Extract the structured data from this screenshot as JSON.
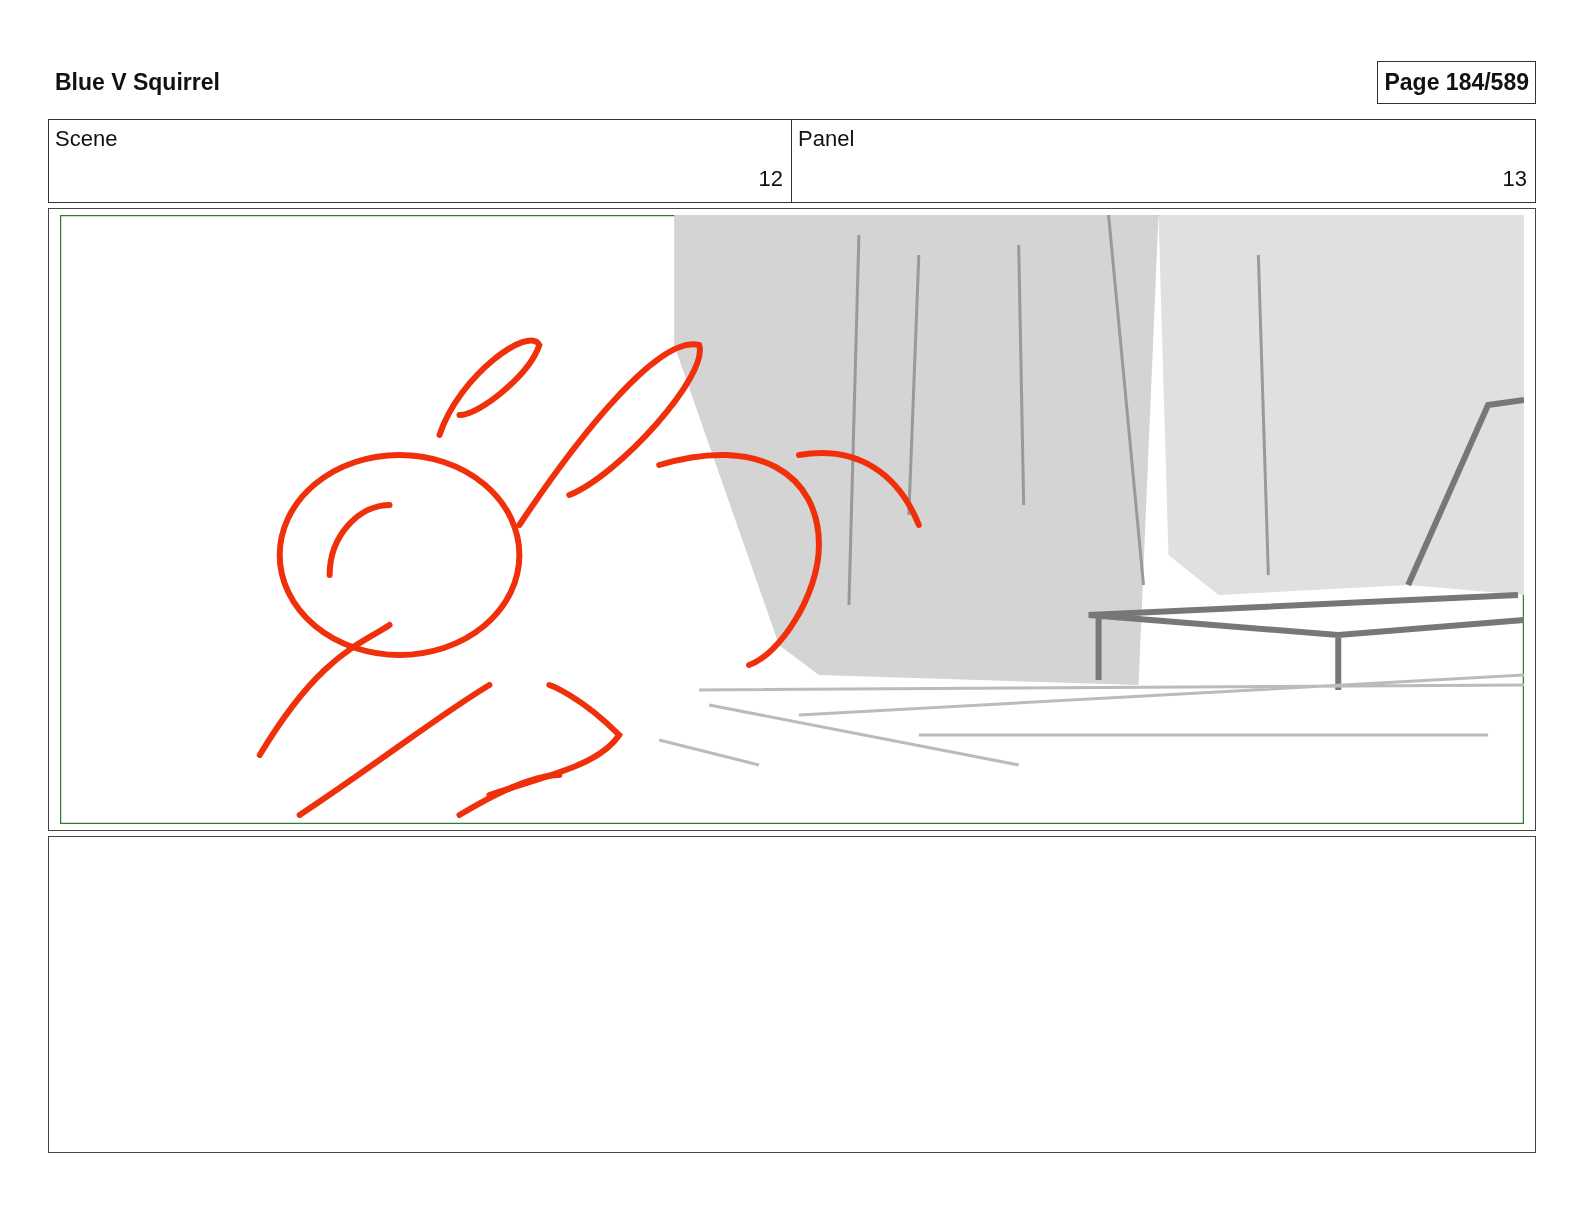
{
  "header": {
    "title": "Blue V Squirrel",
    "page": "Page 184/589"
  },
  "scene": {
    "label": "Scene",
    "number": "12"
  },
  "panel": {
    "label": "Panel",
    "number": "13"
  }
}
